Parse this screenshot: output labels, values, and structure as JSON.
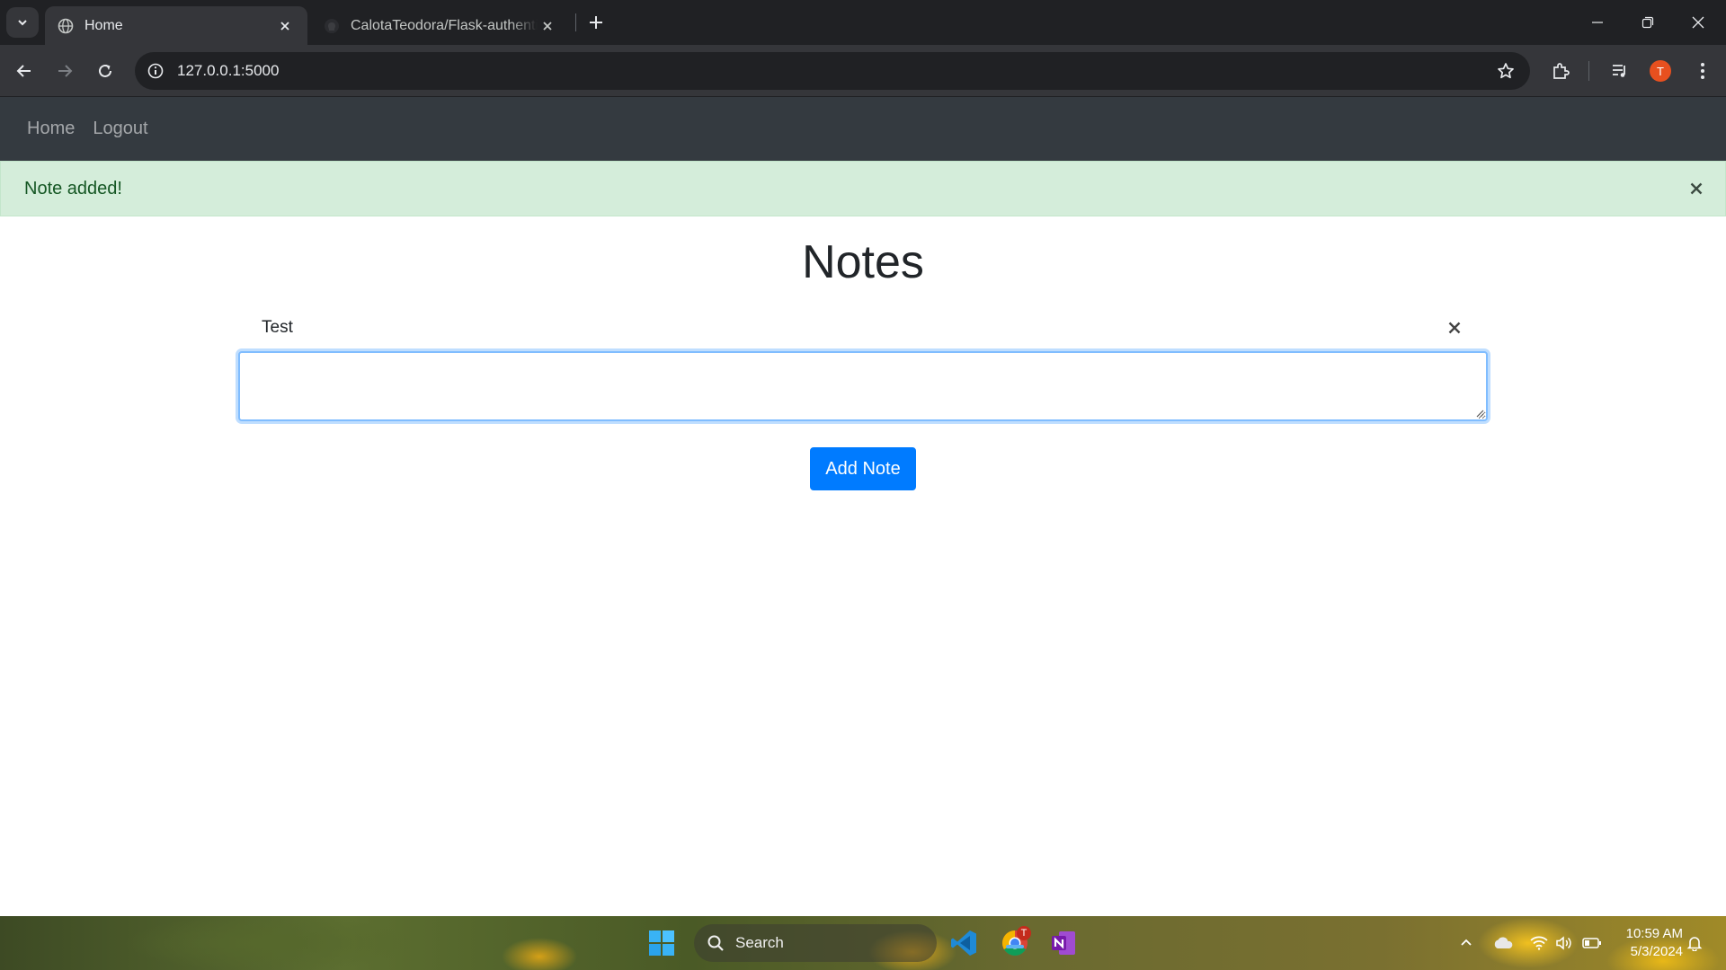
{
  "browser": {
    "tabs": [
      {
        "title": "Home",
        "active": true
      },
      {
        "title": "CalotaTeodora/Flask-authentication",
        "active": false
      }
    ],
    "address": "127.0.0.1:5000",
    "profile_initial": "T"
  },
  "navbar": {
    "links": [
      "Home",
      "Logout"
    ]
  },
  "alert": {
    "message": "Note added!",
    "type": "success"
  },
  "main": {
    "title": "Notes",
    "notes": [
      "Test"
    ],
    "textarea_value": "",
    "add_button_label": "Add Note"
  },
  "taskbar": {
    "search_label": "Search",
    "chrome_badge": "T",
    "time": "10:59 AM",
    "date": "5/3/2024"
  },
  "colors": {
    "navbar_bg": "#343a40",
    "alert_bg": "#d4edda",
    "alert_text": "#155724",
    "primary_button": "#007bff",
    "browser_frame": "#202124",
    "browser_toolbar": "#35363a"
  }
}
